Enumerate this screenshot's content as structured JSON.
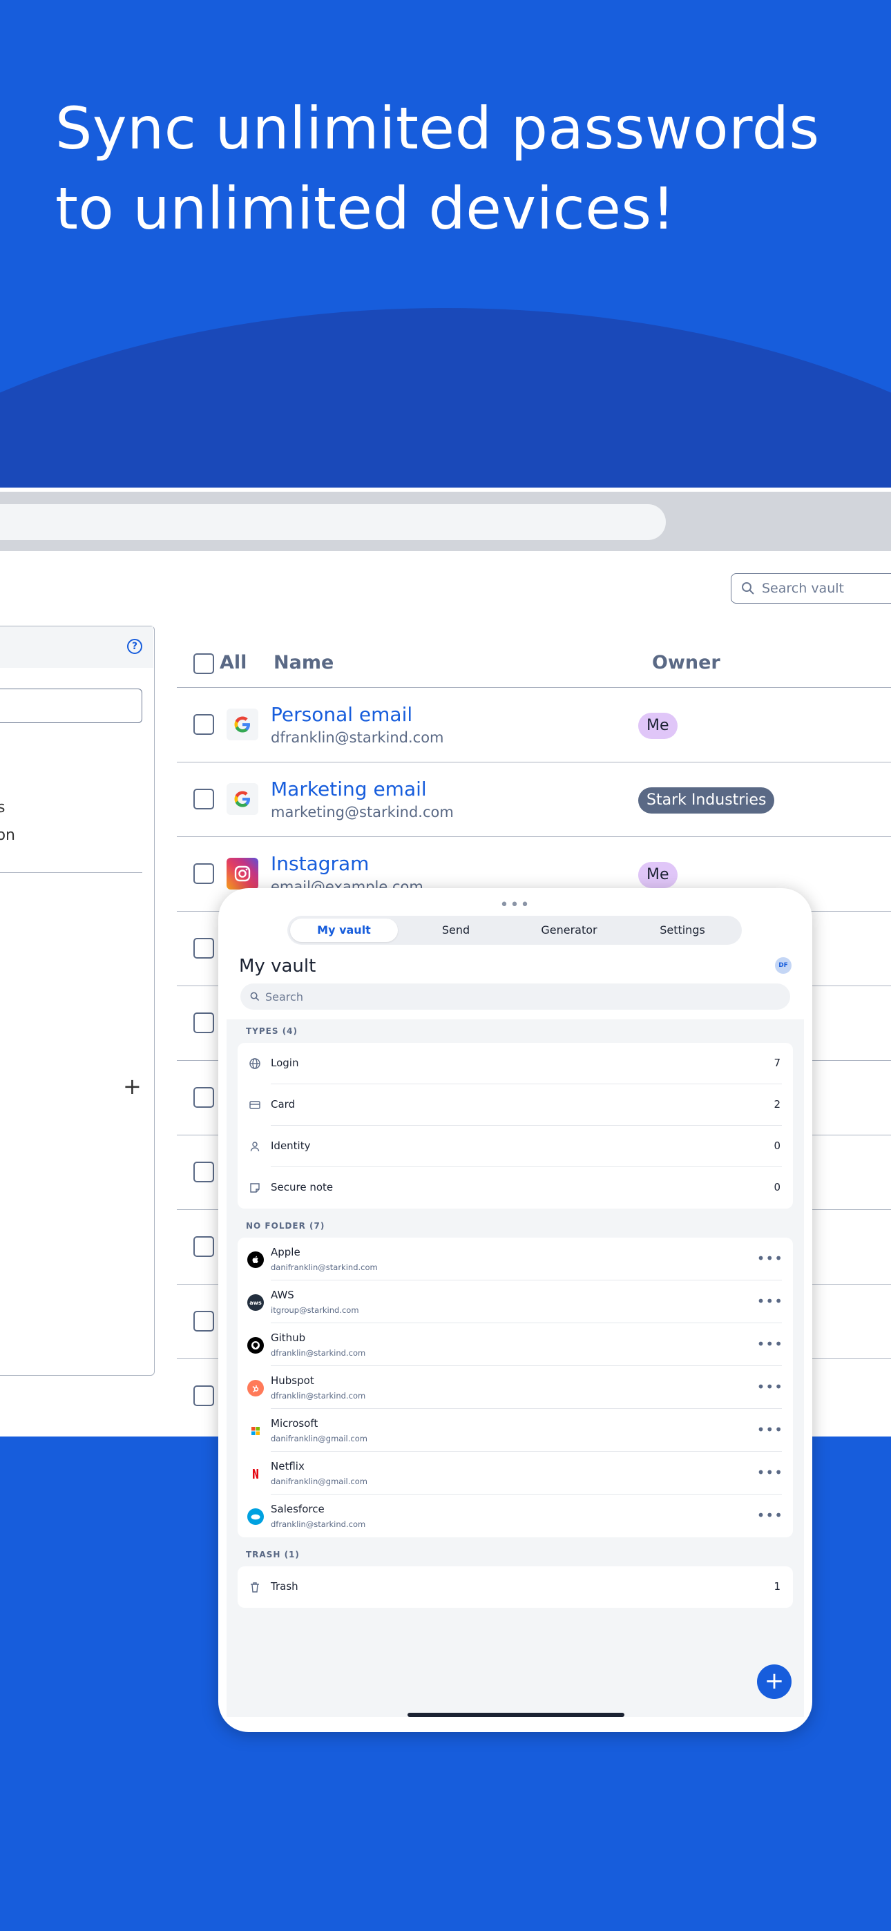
{
  "headline": "Sync unlimited passwords to unlimited devices!",
  "browser": {
    "search_placeholder": "Search vault",
    "sidebar_help": "?",
    "sidebar_fragment_1": "s",
    "sidebar_fragment_2": "on",
    "sidebar_plus": "+"
  },
  "table": {
    "headers": {
      "all": "All",
      "name": "Name",
      "owner": "Owner"
    },
    "rows": [
      {
        "name": "Personal email",
        "sub": "dfranklin@starkind.com",
        "owner": "Me",
        "icon": "google-icon"
      },
      {
        "name": "Marketing email",
        "sub": "marketing@starkind.com",
        "owner": "Stark Industries",
        "icon": "google-icon"
      },
      {
        "name": "Instagram",
        "sub": "email@example.com",
        "owner": "Me",
        "icon": "instagram-icon"
      }
    ]
  },
  "tablet": {
    "dots": "•••",
    "tabs": [
      "My vault",
      "Send",
      "Generator",
      "Settings"
    ],
    "active_tab": "My vault",
    "title": "My vault",
    "avatar": "DF",
    "search_placeholder": "Search",
    "types_heading": "TYPES (4)",
    "types": [
      {
        "label": "Login",
        "count": "7",
        "icon": "globe-icon"
      },
      {
        "label": "Card",
        "count": "2",
        "icon": "card-icon"
      },
      {
        "label": "Identity",
        "count": "0",
        "icon": "person-icon"
      },
      {
        "label": "Secure note",
        "count": "0",
        "icon": "note-icon"
      }
    ],
    "folder_heading": "NO FOLDER (7)",
    "items": [
      {
        "name": "Apple",
        "sub": "danifranklin@starkind.com",
        "icon": "apple-icon"
      },
      {
        "name": "AWS",
        "sub": "itgroup@starkind.com",
        "icon": "aws-icon"
      },
      {
        "name": "Github",
        "sub": "dfranklin@starkind.com",
        "icon": "github-icon"
      },
      {
        "name": "Hubspot",
        "sub": "dfranklin@starkind.com",
        "icon": "hubspot-icon"
      },
      {
        "name": "Microsoft",
        "sub": "danifranklin@gmail.com",
        "icon": "microsoft-icon"
      },
      {
        "name": "Netflix",
        "sub": "danifranklin@gmail.com",
        "icon": "netflix-icon"
      },
      {
        "name": "Salesforce",
        "sub": "dfranklin@starkind.com",
        "icon": "salesforce-icon"
      }
    ],
    "more_label": "•••",
    "trash_heading": "TRASH (1)",
    "trash": {
      "label": "Trash",
      "count": "1",
      "icon": "trash-icon"
    },
    "fab": "+"
  },
  "colors": {
    "brand_blue": "#175ddc",
    "arc_blue": "#1a49b9",
    "owner_me": "#e0c6f8",
    "owner_org": "#5a6985"
  }
}
